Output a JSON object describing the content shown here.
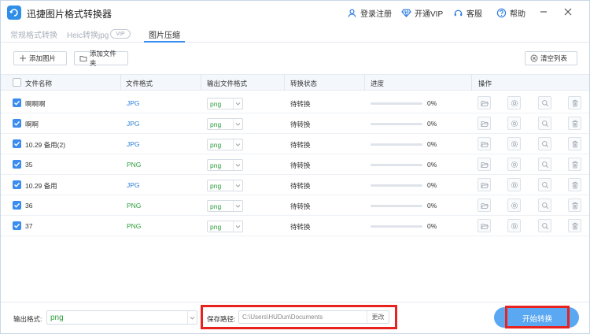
{
  "app": {
    "title": "迅捷图片格式转换器"
  },
  "titlebar": {
    "login": "登录注册",
    "vip": "开通VIP",
    "service": "客服",
    "help": "帮助"
  },
  "tabs": [
    {
      "label": "常规格式转换"
    },
    {
      "label": "Heic转换jpg"
    },
    {
      "label": "图片压缩"
    }
  ],
  "vip_badge": "VIP",
  "toolbar": {
    "add_image": "添加图片",
    "add_folder": "添加文件夹",
    "clear_list": "清空列表"
  },
  "table": {
    "headers": {
      "name": "文件名称",
      "format": "文件格式",
      "output": "输出文件格式",
      "status": "转换状态",
      "progress": "进度",
      "actions": "操作"
    },
    "rows": [
      {
        "name": "啊啊啊",
        "format": "JPG",
        "output": "png",
        "status": "待转换",
        "progress": "0%"
      },
      {
        "name": "啊啊",
        "format": "JPG",
        "output": "png",
        "status": "待转换",
        "progress": "0%"
      },
      {
        "name": "10.29 备用(2)",
        "format": "JPG",
        "output": "png",
        "status": "待转换",
        "progress": "0%"
      },
      {
        "name": "35",
        "format": "PNG",
        "output": "png",
        "status": "待转换",
        "progress": "0%"
      },
      {
        "name": "10.29 备用",
        "format": "JPG",
        "output": "png",
        "status": "待转换",
        "progress": "0%"
      },
      {
        "name": "36",
        "format": "PNG",
        "output": "png",
        "status": "待转换",
        "progress": "0%"
      },
      {
        "name": "37",
        "format": "PNG",
        "output": "png",
        "status": "待转换",
        "progress": "0%"
      }
    ]
  },
  "bottom": {
    "output_format_label": "输出格式:",
    "output_format_value": "png",
    "save_path_label": "保存路径:",
    "save_path_value": "C:\\Users\\HUDun\\Documents",
    "change_label": "更改",
    "start_label": "开始转换"
  },
  "colors": {
    "accent": "#3b8cf0",
    "jpg": "#2b7fd6",
    "png": "#2a9d3a",
    "highlight": "#e8231f",
    "start_button": "#5aa7f2"
  }
}
